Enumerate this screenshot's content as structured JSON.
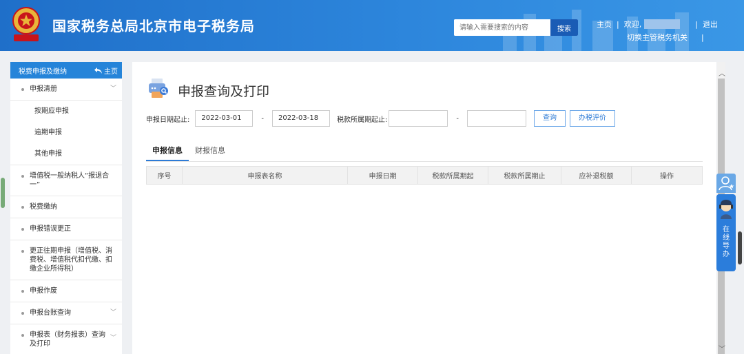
{
  "header": {
    "site_title": "国家税务总局北京市电子税务局",
    "search_placeholder": "请输入需要搜索的内容",
    "search_button": "搜索",
    "nav_home": "主页",
    "nav_sep": "|",
    "welcome": "欢迎,",
    "logout": "退出",
    "switch_authority": "切换主管税务机关",
    "emblem_text": "中国税务"
  },
  "sidebar": {
    "title": "税费申报及缴纳",
    "home_label": "主页",
    "items": [
      {
        "label": "申报清册",
        "expanded": true
      },
      {
        "label": "按期应申报",
        "sub": true
      },
      {
        "label": "逾期申报",
        "sub": true
      },
      {
        "label": "其他申报",
        "sub": true
      },
      {
        "label": "增值税一般纳税人“报退合一”"
      },
      {
        "label": "税费缴纳"
      },
      {
        "label": "申报错误更正"
      },
      {
        "label": "更正往期申报（增值税、消费税、增值税代扣代缴、扣缴企业所得税）"
      },
      {
        "label": "申报作废"
      },
      {
        "label": "申报台账查询",
        "expandable": true
      },
      {
        "label": "申报表（财务报表）查询及打印",
        "expandable": true
      }
    ]
  },
  "main": {
    "title": "申报查询及打印",
    "filter": {
      "date_from_label": "申报日期起止:",
      "date_from": "2022-03-01",
      "dash": "-",
      "date_to": "2022-03-18",
      "period_label": "税款所属期起止:",
      "period_from": "",
      "period_to": "",
      "query_button": "查询",
      "evaluate_button": "办税评价"
    },
    "tabs": [
      "申报信息",
      "财报信息"
    ],
    "active_tab": 0,
    "table": {
      "columns": [
        "序号",
        "申报表名称",
        "申报日期",
        "税款所属期起",
        "税款所属期止",
        "应补退税额",
        "操作"
      ],
      "rows": []
    }
  },
  "guide": {
    "label": "在线导办"
  },
  "colors": {
    "header_blue": "#2584d9",
    "accent": "#2d7bd6"
  }
}
